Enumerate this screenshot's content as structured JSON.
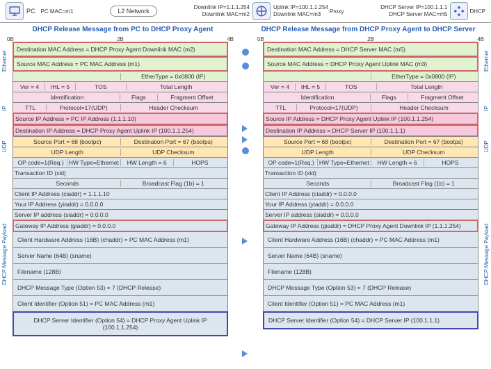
{
  "top": {
    "pc_mac": "PC MAC=m1",
    "l2": "L2 Network",
    "proxy_dl_ip": "Downlink IP=1.1.1.254",
    "proxy_dl_mac": "Downlink MAC=m2",
    "proxy_ul_ip": "Uplink IP=100.1.1.254",
    "proxy_ul_mac": "Downlink MAC=m3",
    "dhcp_ip": "DHCP Server IP=100.1.1.1",
    "dhcp_mac": "DHCP Server MAC=m5",
    "pc_label": "PC",
    "proxy_label": "Proxy",
    "dhcp_label": "DHCP"
  },
  "titles": {
    "left": "DHCP Release Message from PC to DHCP Proxy Agent",
    "right": "DHCP Release Message from DHCP Proxy Agent to DHCP Server"
  },
  "offsets": {
    "b0": "0B",
    "b2": "2B",
    "b4": "4B"
  },
  "vlabels": {
    "eth": "Ethernet",
    "ip": "IP",
    "udp": "UDP",
    "pl": "DHCP Message Payload"
  },
  "left": {
    "eth_dst": "Destination MAC Address = DHCP Proxy Agent Downlink MAC (m2)",
    "eth_src": "Source MAC Address = PC MAC Address (m1)",
    "eth_type": "EtherType = 0x0800 (IP)",
    "ip_r1_a": "Ver = 4",
    "ip_r1_b": "IHL = 5",
    "ip_r1_c": "TOS",
    "ip_r1_d": "Total Length",
    "ip_r2_a": "Identification",
    "ip_r2_b": "Flags",
    "ip_r2_c": "Fragment Offset",
    "ip_r3_a": "TTL",
    "ip_r3_b": "Protocol=17(UDP)",
    "ip_r3_c": "Header Checksum",
    "ip_src": "Source IP Address = PC IP Address (1.1.1.10)",
    "ip_dst": "Destination IP Address = DHCP Proxy Agent Uplink IP (100.1.1.254)",
    "udp_sp": "Source Port = 68 (bootpc)",
    "udp_dp": "Destination Port = 67 (bootps)",
    "udp_len": "UDP Length",
    "udp_ck": "UDP Checksum",
    "pl_r1_a": "OP code=1(Req.)",
    "pl_r1_b": "HW Type=Ethernet",
    "pl_r1_c": "HW Length = 6",
    "pl_r1_d": "HOPS",
    "pl_xid": "Transaction ID (xid)",
    "pl_sec": "Seconds",
    "pl_bf": "Broadcast Flag (1b) = 1",
    "pl_ci": "Client IP Address (ciaddr) = 1.1.1.10",
    "pl_yi": "Your IP Address (yiaddr) = 0.0.0.0",
    "pl_si": "Server IP address (siaddr) = 0.0.0.0",
    "pl_gi": "Gateway IP Address (giaddr) = 0.0.0.0",
    "pl_ch": "Client Hardware Address (16B) (chaddr) = PC MAC Address (m1)",
    "pl_sn": "Server Name (64B) (sname)",
    "pl_fn": "Filename (128B)",
    "pl_mt": "DHCP Message Type (Option 53) = 7 (DHCP Release)",
    "pl_cid": "Client Identifier (Option 51) = PC MAC Address (m1)",
    "pl_sid": "DHCP Server Identifier (Option 54) = DHCP Proxy Agent Uplink IP (100.1.1.254)"
  },
  "right": {
    "eth_dst": "Destination MAC Address = DHCP Server MAC (m5)",
    "eth_src": "Source MAC Address = DHCP Proxy Agent Uplink MAC (m3)",
    "eth_type": "EtherType = 0x0800 (IP)",
    "ip_r1_a": "Ver = 4",
    "ip_r1_b": "IHL = 5",
    "ip_r1_c": "TOS",
    "ip_r1_d": "Total Length",
    "ip_r2_a": "Identification",
    "ip_r2_b": "Flags",
    "ip_r2_c": "Fragment Offset",
    "ip_r3_a": "TTL",
    "ip_r3_b": "Protocol=17(UDP)",
    "ip_r3_c": "Header Checksum",
    "ip_src": "Source IP Address = DHCP Proxy Agent Uplink IP (100.1.1.254)",
    "ip_dst": "Destination IP Address = DHCP Server IP (100.1.1.1)",
    "udp_sp": "Source Port = 68 (bootpc)",
    "udp_dp": "Destination Port = 67 (bootps)",
    "udp_len": "UDP Length",
    "udp_ck": "UDP Checksum",
    "pl_r1_a": "OP code=1(Req.)",
    "pl_r1_b": "HW Type=Ethernet",
    "pl_r1_c": "HW Length = 6",
    "pl_r1_d": "HOPS",
    "pl_xid": "Transaction ID (xid)",
    "pl_sec": "Seconds",
    "pl_bf": "Broadcast Flag (1b) = 1",
    "pl_ci": "Client IP Address (ciaddr) = 0.0.0.0",
    "pl_yi": "Your IP Address (yiaddr) = 0.0.0.0",
    "pl_si": "Server IP address (siaddr) = 0.0.0.0",
    "pl_gi": "Gateway IP Address (giaddr) = DHCP Proxy Agent Downlink IP (1.1.1.254)",
    "pl_ch": "Client Hardware Address (16B) (chaddr) = PC MAC Address (m1)",
    "pl_sn": "Server Name (64B) (sname)",
    "pl_fn": "Filename (128B)",
    "pl_mt": "DHCP Message Type (Option 53) = 7 (DHCP Release)",
    "pl_cid": "Client Identifier (Option 51) = PC MAC Address (m1)",
    "pl_sid": "DHCP Server Identifier (Option 54) = DHCP Server IP (100.1.1.1)"
  }
}
